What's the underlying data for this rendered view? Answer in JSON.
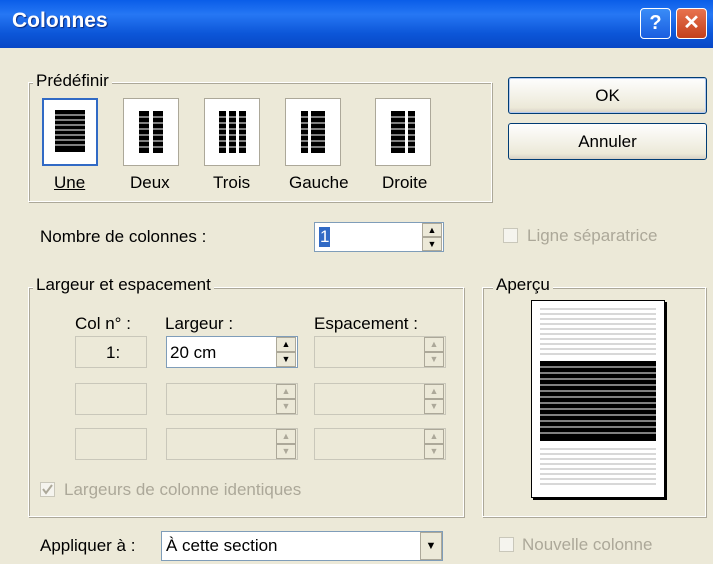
{
  "window": {
    "title": "Colonnes",
    "help_glyph": "?",
    "close_glyph": "✕"
  },
  "presets": {
    "group_label": "Prédéfinir",
    "items": [
      {
        "label": "Une",
        "selected": true
      },
      {
        "label": "Deux",
        "selected": false
      },
      {
        "label": "Trois",
        "selected": false
      },
      {
        "label": "Gauche",
        "selected": false
      },
      {
        "label": "Droite",
        "selected": false
      }
    ]
  },
  "buttons": {
    "ok": "OK",
    "cancel": "Annuler"
  },
  "count": {
    "label": "Nombre de colonnes :",
    "value": "1"
  },
  "separator": {
    "label": "Ligne séparatrice",
    "checked": false,
    "enabled": false
  },
  "widths": {
    "group_label": "Largeur et espacement",
    "col_header": "Col n° :",
    "width_header": "Largeur :",
    "spacing_header": "Espacement :",
    "rows": [
      {
        "col": "1:",
        "width": "20 cm",
        "spacing": ""
      },
      {
        "col": "",
        "width": "",
        "spacing": ""
      },
      {
        "col": "",
        "width": "",
        "spacing": ""
      }
    ],
    "equal_label": "Largeurs de colonne identiques",
    "equal_checked": true
  },
  "preview": {
    "group_label": "Aperçu"
  },
  "apply": {
    "label": "Appliquer à :",
    "value": "À cette section"
  },
  "new_column": {
    "label": "Nouvelle colonne",
    "checked": false
  },
  "colors": {
    "title_bar": "#0a5de8",
    "dialog_bg": "#ece9d8",
    "selection": "#316ac5"
  }
}
